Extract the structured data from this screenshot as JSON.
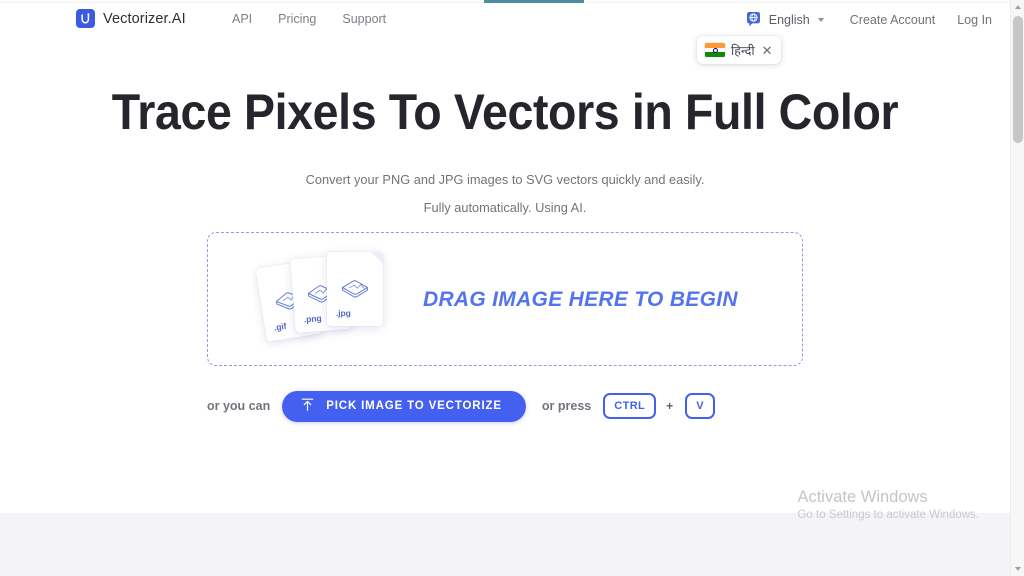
{
  "browser": {
    "scrollbar": {
      "up_arrow_icon": "chevron-up-icon",
      "down_arrow_icon": "chevron-down-icon"
    }
  },
  "header": {
    "brand": {
      "name": "Vectorizer.AI",
      "logo_icon": "vectorizer-logo-icon",
      "logo_color": "#3c5be0"
    },
    "nav_links": [
      {
        "label": "API"
      },
      {
        "label": "Pricing"
      },
      {
        "label": "Support"
      }
    ],
    "language": {
      "icon": "globe-icon",
      "label": "English",
      "caret_icon": "caret-down-icon"
    },
    "account_links": [
      {
        "label": "Create Account"
      },
      {
        "label": "Log In"
      }
    ],
    "language_popup": {
      "flag_icon": "flag-india-icon",
      "label": "हिन्दी",
      "close_icon": "close-icon"
    }
  },
  "hero": {
    "title": "Trace Pixels To Vectors in Full Color",
    "subtitle_line1": "Convert your PNG and JPG images to SVG vectors quickly and easily.",
    "subtitle_line2": "Fully automatically. Using AI."
  },
  "dropzone": {
    "prompt": "DRAG IMAGE HERE TO BEGIN",
    "prompt_color": "#5474ef",
    "border_color": "#8b9cf0",
    "file_cards": [
      {
        "ext": ".gif",
        "icon": "image-file-icon"
      },
      {
        "ext": ".png",
        "icon": "image-file-icon"
      },
      {
        "ext": ".jpg",
        "icon": "image-file-icon"
      }
    ]
  },
  "actions": {
    "or_you_can": "or you can",
    "pick_button": {
      "label": "PICK IMAGE TO VECTORIZE",
      "icon": "upload-icon",
      "color": "#4460f1"
    },
    "or_press": "or press",
    "keys": [
      {
        "label": "CTRL"
      },
      {
        "label": "V"
      }
    ],
    "key_separator": "+"
  },
  "watermark": {
    "title": "Activate Windows",
    "subtitle": "Go to Settings to activate Windows."
  }
}
